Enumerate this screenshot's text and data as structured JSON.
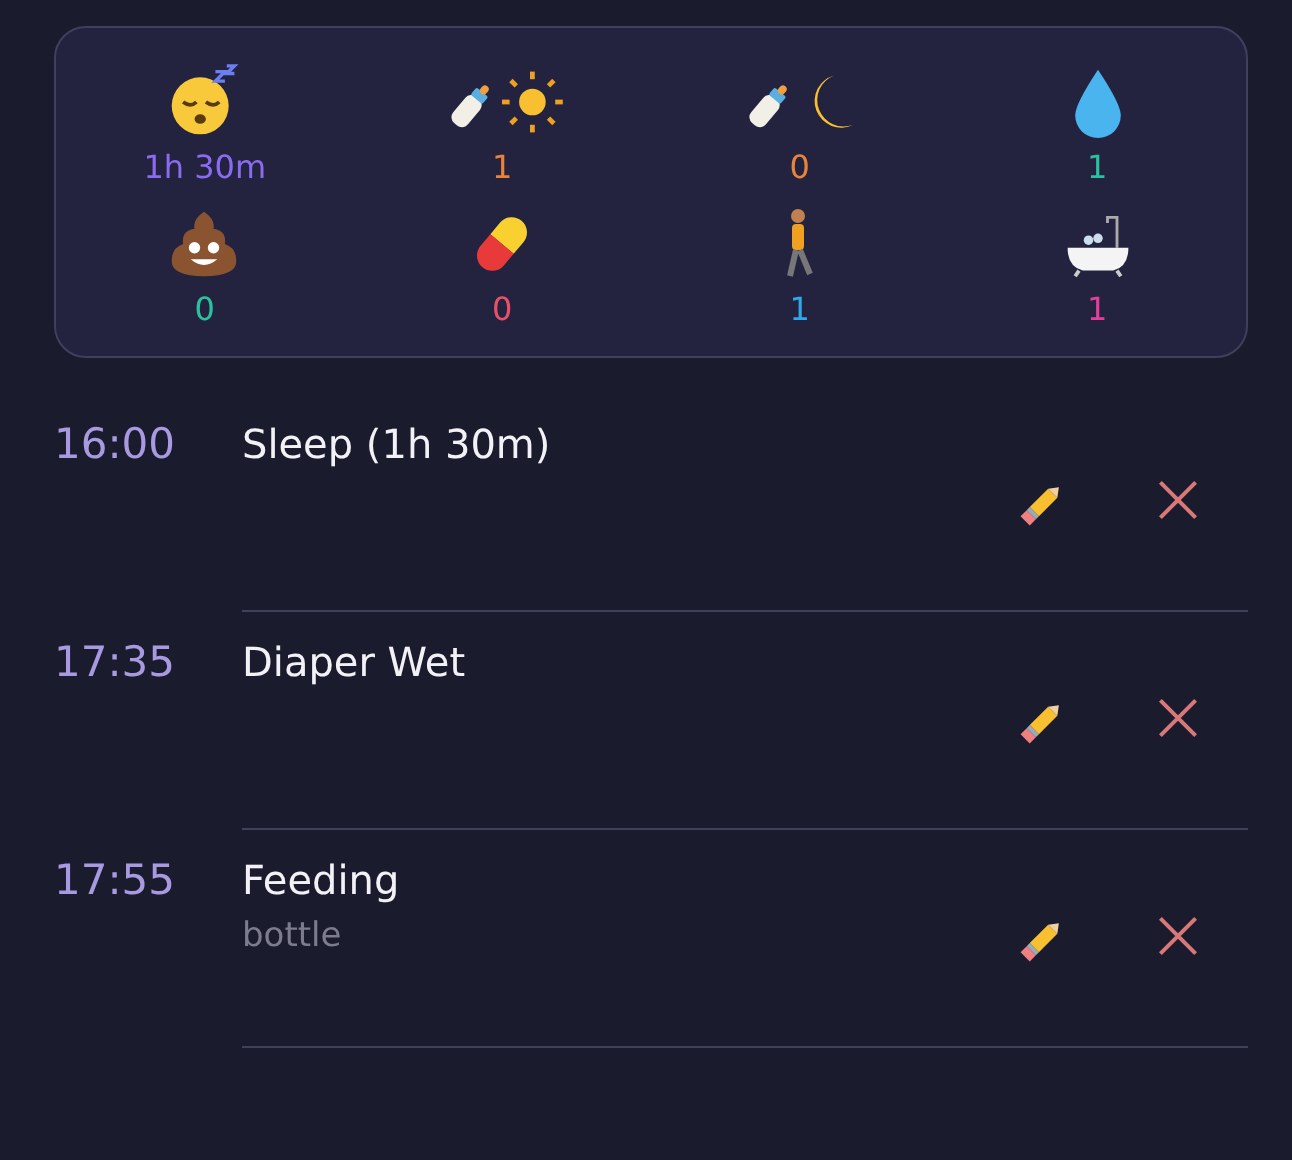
{
  "summary": [
    {
      "kind": "sleep",
      "value": "1h 30m",
      "color": "#8b6cf0"
    },
    {
      "kind": "feed-day",
      "value": "1",
      "color": "#e8833a"
    },
    {
      "kind": "feed-night",
      "value": "0",
      "color": "#e8833a"
    },
    {
      "kind": "wet",
      "value": "1",
      "color": "#2bc0a0"
    },
    {
      "kind": "dirty",
      "value": "0",
      "color": "#2bc0a0"
    },
    {
      "kind": "medicine",
      "value": "0",
      "color": "#e8506a"
    },
    {
      "kind": "walk",
      "value": "1",
      "color": "#2ea8e8"
    },
    {
      "kind": "bath",
      "value": "1",
      "color": "#e0409a"
    }
  ],
  "entries": [
    {
      "time": "16:00",
      "title": "Sleep (1h 30m)"
    },
    {
      "time": "17:35",
      "title": "Diaper Wet"
    },
    {
      "time": "17:55",
      "title": "Feeding",
      "note": "bottle"
    }
  ]
}
